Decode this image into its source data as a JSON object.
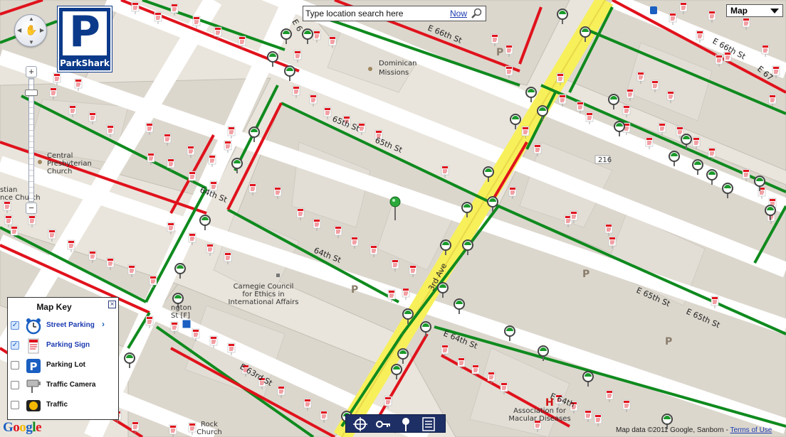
{
  "app": {
    "brand": "ParkShark",
    "brand_letter": "P"
  },
  "search": {
    "placeholder": "Type location search here",
    "now_label": "Now"
  },
  "map_type": {
    "selected": "Map"
  },
  "map_key": {
    "title": "Map Key",
    "items": [
      {
        "label": "Street Parking",
        "checked": true,
        "icon": "alarm-clock-icon",
        "has_more": true
      },
      {
        "label": "Parking Sign",
        "checked": true,
        "icon": "parking-sign-icon"
      },
      {
        "label": "Parking Lot",
        "checked": false,
        "icon": "parking-lot-icon"
      },
      {
        "label": "Traffic Camera",
        "checked": false,
        "icon": "traffic-camera-icon"
      },
      {
        "label": "Traffic",
        "checked": false,
        "icon": "traffic-light-icon"
      }
    ]
  },
  "streets": {
    "e66": "E 66th St",
    "e67": "E 67",
    "e65": "E 65th St",
    "e65_short": "65th St",
    "e65_short2": "65th St",
    "e65_right": "E 65th St",
    "e65_right2": "E 65th St",
    "e64": "E 64th St",
    "e64_left": "64th St",
    "e64_mid": "64th St",
    "e64_right": "E 64th",
    "e63": "E 63rd St",
    "third_ave": "3rd Ave",
    "e64_top": "E 6",
    "e66_right": "E 66th St",
    "lex_top": "le"
  },
  "pois": {
    "dominican": "Dominican Missions",
    "central_pres": "Central Presbyterian Church",
    "christian_science": "stian nce Church",
    "carnegie": "Carnegie Council for Ethics in International Affairs",
    "macular": "Association for Macular Diseases",
    "rock_church": "Rock Church",
    "lexington": "ngton",
    "lexington_st": "St [F]",
    "route_shield": "216"
  },
  "toolbar": [
    "crosshair-icon",
    "key-icon",
    "pin-icon",
    "list-icon"
  ],
  "footer": {
    "google": "Google",
    "copyright": "Map data ©2011 Google, Sanborn - ",
    "terms": "Terms of Use"
  },
  "colors": {
    "parking_green": "#0f8a1e",
    "no_parking_red": "#e0121c",
    "avenue_yellow": "#f7f05a",
    "logo_blue": "#0b3a8a"
  }
}
